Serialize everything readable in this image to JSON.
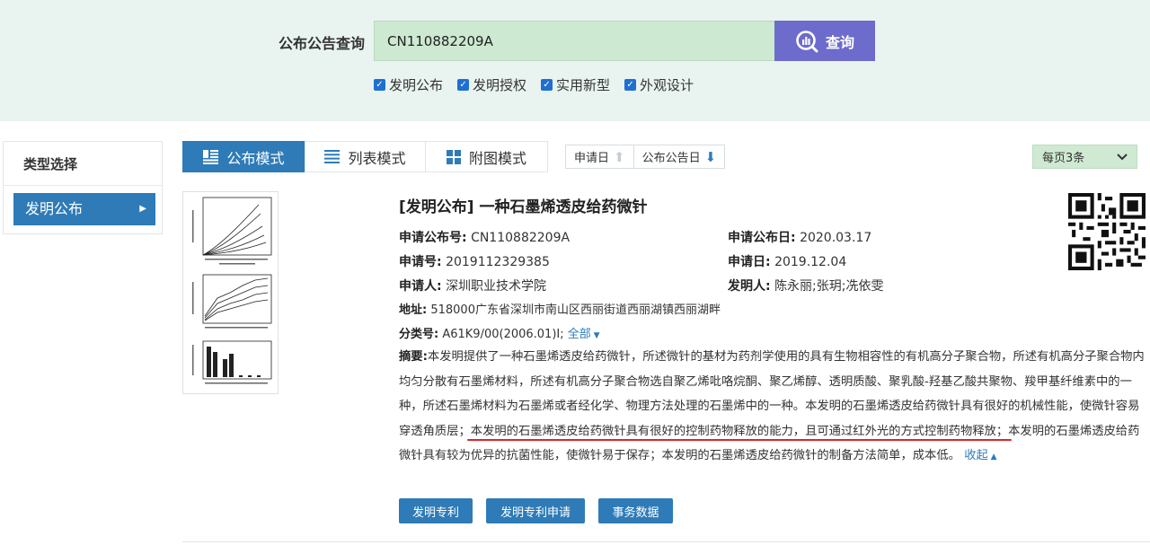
{
  "search": {
    "label": "公布公告查询",
    "value": "CN110882209A",
    "button_label": "查询",
    "options": [
      {
        "label": "发明公布",
        "checked": true
      },
      {
        "label": "发明授权",
        "checked": true
      },
      {
        "label": "实用新型",
        "checked": true
      },
      {
        "label": "外观设计",
        "checked": true
      }
    ]
  },
  "sidebar": {
    "title": "类型选择",
    "items": [
      {
        "label": "发明公布"
      }
    ]
  },
  "toolbar": {
    "modes": [
      {
        "label": "公布模式",
        "active": true
      },
      {
        "label": "列表模式",
        "active": false
      },
      {
        "label": "附图模式",
        "active": false
      }
    ],
    "sort": [
      {
        "label": "申请日"
      },
      {
        "label": "公布公告日"
      }
    ],
    "per_page": "每页3条"
  },
  "record": {
    "title": "[发明公布] 一种石墨烯透皮给药微针",
    "pub_no_label": "申请公布号:",
    "pub_no": "CN110882209A",
    "pub_date_label": "申请公布日:",
    "pub_date": "2020.03.17",
    "app_no_label": "申请号:",
    "app_no": "2019112329385",
    "app_date_label": "申请日:",
    "app_date": "2019.12.04",
    "applicant_label": "申请人:",
    "applicant": "深圳职业技术学院",
    "inventor_label": "发明人:",
    "inventor": "陈永丽;张玥;冼依雯",
    "address_label": "地址:",
    "address": "518000广东省深圳市南山区西丽街道西丽湖镇西丽湖畔",
    "class_label": "分类号:",
    "class_no": "A61K9/00(2006.01)I;",
    "class_more": "全部",
    "abstract_label": "摘要:",
    "abstract_part1": "本发明提供了一种石墨烯透皮给药微针，所述微针的基材为药剂学使用的具有生物相容性的有机高分子聚合物，所述有机高分子聚合物内均匀分散有石墨烯材料，所述有机高分子聚合物选自聚乙烯吡咯烷酮、聚乙烯醇、透明质酸、聚乳酸-羟基乙酸共聚物、羧甲基纤维素中的一种，所述石墨烯材料为石墨烯或者经化学、物理方法处理的石墨烯中的一种。本发明的石墨烯透皮给药微针具有很好的机械性能，使微针容易穿透角质层；",
    "abstract_highlight": "本发明的石墨烯透皮给药微针具有很好的控制药物释放的能力，且可通过红外光的方式控制药物释放；",
    "abstract_part2": "本发明的石墨烯透皮给药微针具有较为优异的抗菌性能，使微针易于保存；本发明的石墨烯透皮给药微针的制备方法简单，成本低。",
    "collapse": "收起"
  },
  "actions": [
    {
      "label": "发明专利"
    },
    {
      "label": "发明专利申请"
    },
    {
      "label": "事务数据"
    }
  ],
  "colors": {
    "accent": "#2e7bb8",
    "search_bg": "#e9f4f1",
    "input_bg": "#cde9d1",
    "search_button": "#6d6bcb",
    "highlight_underline": "#d8252b"
  }
}
